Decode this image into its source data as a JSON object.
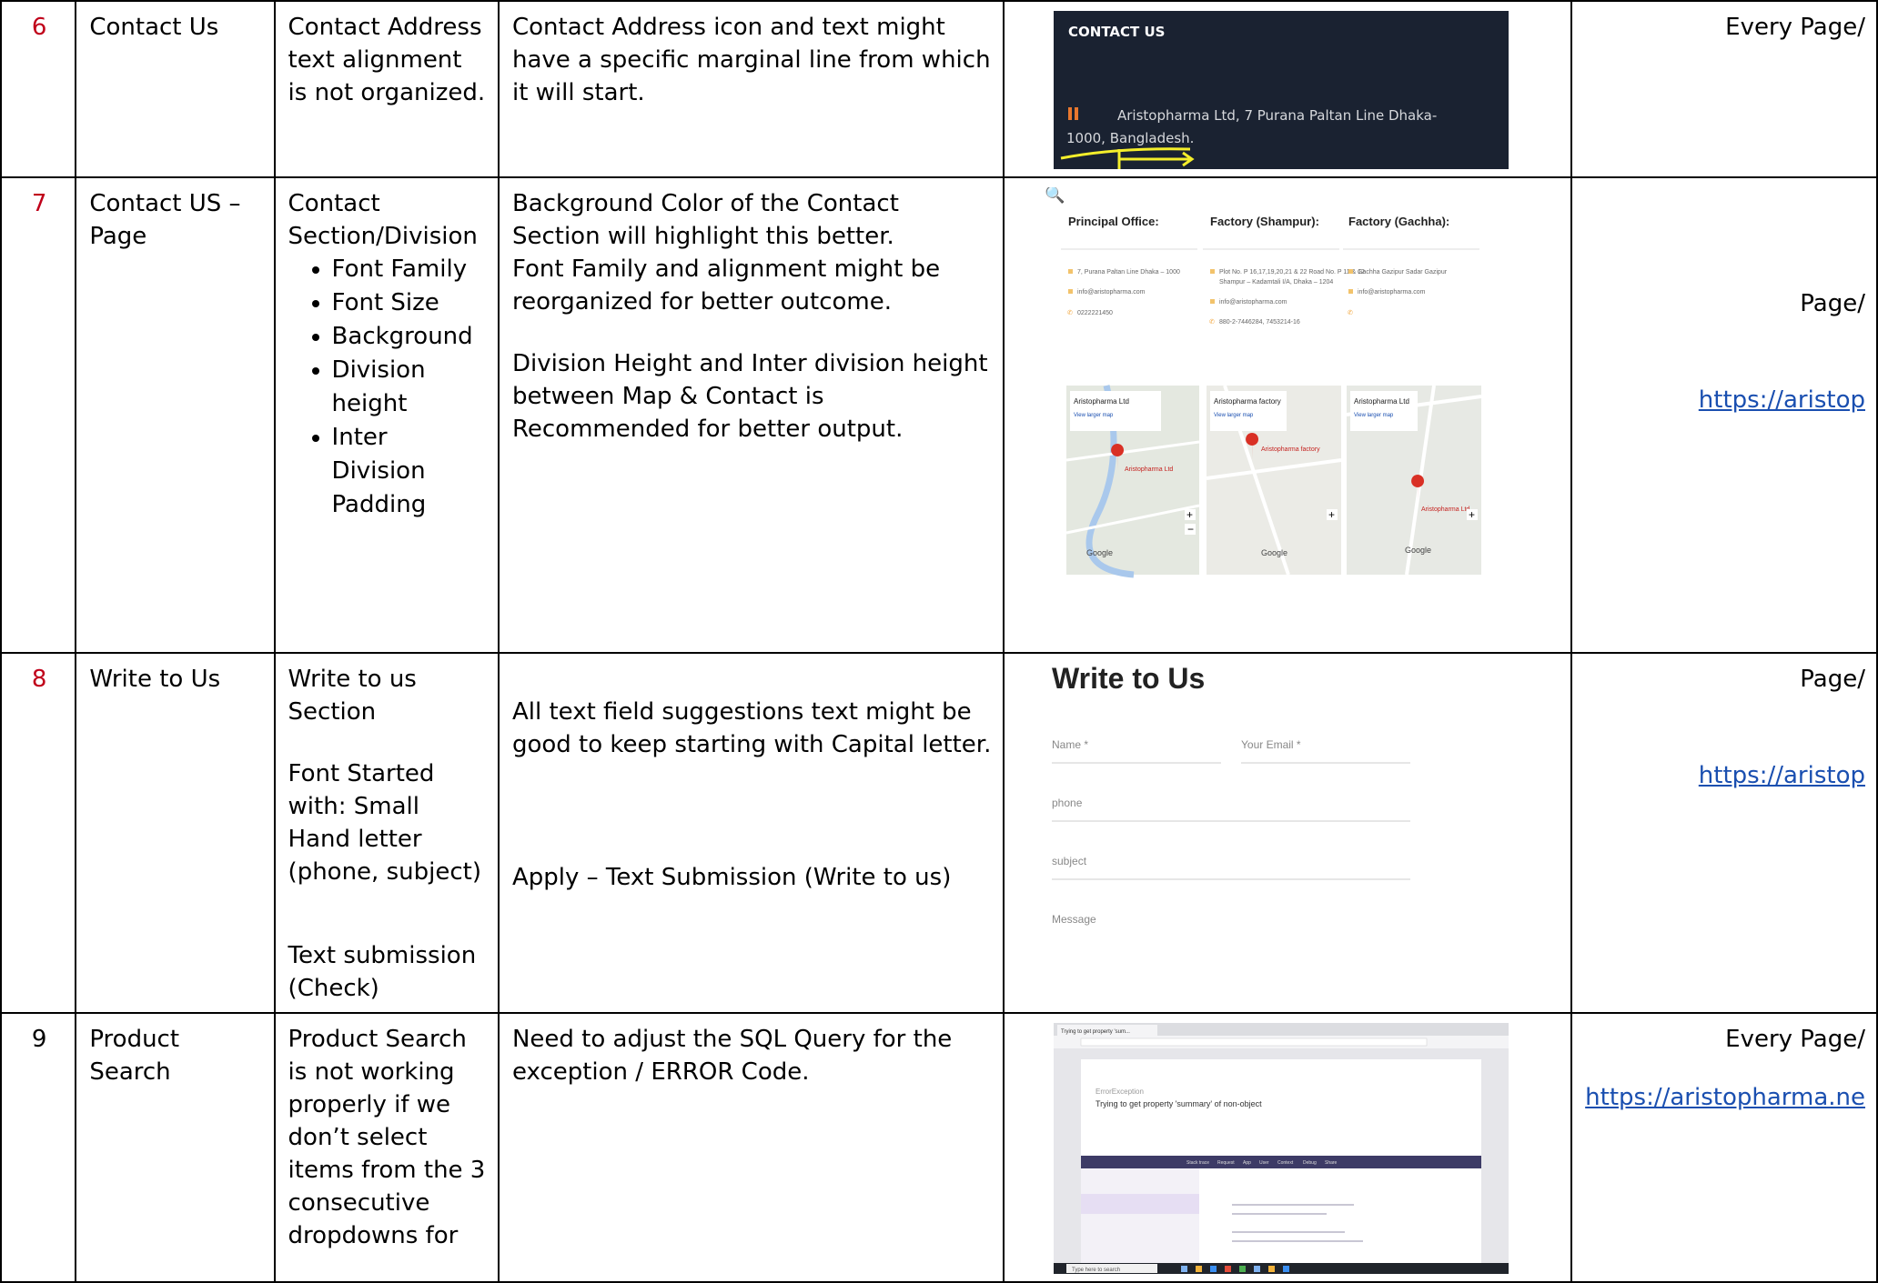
{
  "rows": [
    {
      "num": "6",
      "page": "Contact Us",
      "element": "Contact Address text alignment is not organized.",
      "remark": "Contact Address icon and text might have a specific marginal line from which it will start.",
      "location_lines": [
        "Every Page/"
      ],
      "screenshot": {
        "heading": "CONTACT US",
        "address_line1": "Aristopharma Ltd, 7 Purana Paltan Line Dhaka-",
        "address_line2": "1000, Bangladesh."
      }
    },
    {
      "num": "7",
      "page": "Contact US – Page",
      "element_title": "Contact Section/Division",
      "element_bullets": [
        "Font Family",
        "Font Size",
        "Background",
        "Division height",
        "Inter Division Padding"
      ],
      "remark_lines": [
        "Background Color of the Contact Section will highlight this better.",
        "Font Family and alignment might be reorganized for better outcome.",
        "Division Height and Inter division height between Map & Contact is Recommended for better output."
      ],
      "location_lines": [
        "Page/",
        "https://aristop"
      ],
      "screenshot": {
        "columns": [
          {
            "title": "Principal Office:",
            "lines": [
              "7, Purana Paltan Line Dhaka – 1000",
              "info@aristopharma.com",
              "0222221450"
            ],
            "map_label": "Aristopharma Ltd",
            "map_link": "View larger map",
            "pin": "Aristopharma Ltd"
          },
          {
            "title": "Factory (Shampur):",
            "lines": [
              "Plot No. P 16,17,19,20,21 & 22 Road No. P 11 & 12",
              "Shampur – Kadamtali I/A, Dhaka – 1204",
              "info@aristopharma.com",
              "880-2-7446284, 7453214-16"
            ],
            "map_label": "Aristopharma factory",
            "map_link": "View larger map",
            "pin": "Aristopharma factory"
          },
          {
            "title": "Factory (Gachha):",
            "lines": [
              "Gachha Gazipur Sadar Gazipur",
              "info@aristopharma.com",
              ""
            ],
            "map_label": "Aristopharma Ltd",
            "map_link": "View larger map",
            "pin": "Aristopharma Ltd"
          }
        ],
        "google": "Google"
      }
    },
    {
      "num": "8",
      "page": "Write to Us",
      "element_parts": [
        "Write to us Section",
        "Font Started with: Small Hand letter (phone, subject)",
        "Text submission (Check)"
      ],
      "remark_lines": [
        "All text field suggestions text might be good to keep starting with Capital letter.",
        "Apply – Text Submission (Write to us)"
      ],
      "location_lines": [
        "Page/",
        "https://aristop"
      ],
      "screenshot": {
        "title": "Write to Us",
        "fields": [
          "Name *",
          "Your Email *",
          "phone",
          "subject",
          "Message"
        ]
      }
    },
    {
      "num": "9",
      "page": "Product Search",
      "element": "Product Search is not working properly if we don’t select items from the 3 consecutive dropdowns for",
      "remark": "Need to adjust the SQL Query for the exception / ERROR Code.",
      "location_lines": [
        "Every Page/",
        "https://aristopharma.ne"
      ],
      "screenshot": {
        "tab": "Trying to get property 'sum...",
        "exception": "ErrorException",
        "message": "Trying to get property 'summary' of non-object",
        "search_placeholder": "Type here to search",
        "nav": [
          "Stack trace",
          "Request",
          "App",
          "User",
          "Context",
          "Debug",
          "Share"
        ]
      }
    }
  ],
  "colors": {
    "row_number": "#c0001a",
    "link": "#1a4fb0",
    "contact_bg": "#1a2231",
    "contact_icon": "#e8772e",
    "highlight": "#f4ee2b",
    "map_pin": "#d93025"
  }
}
